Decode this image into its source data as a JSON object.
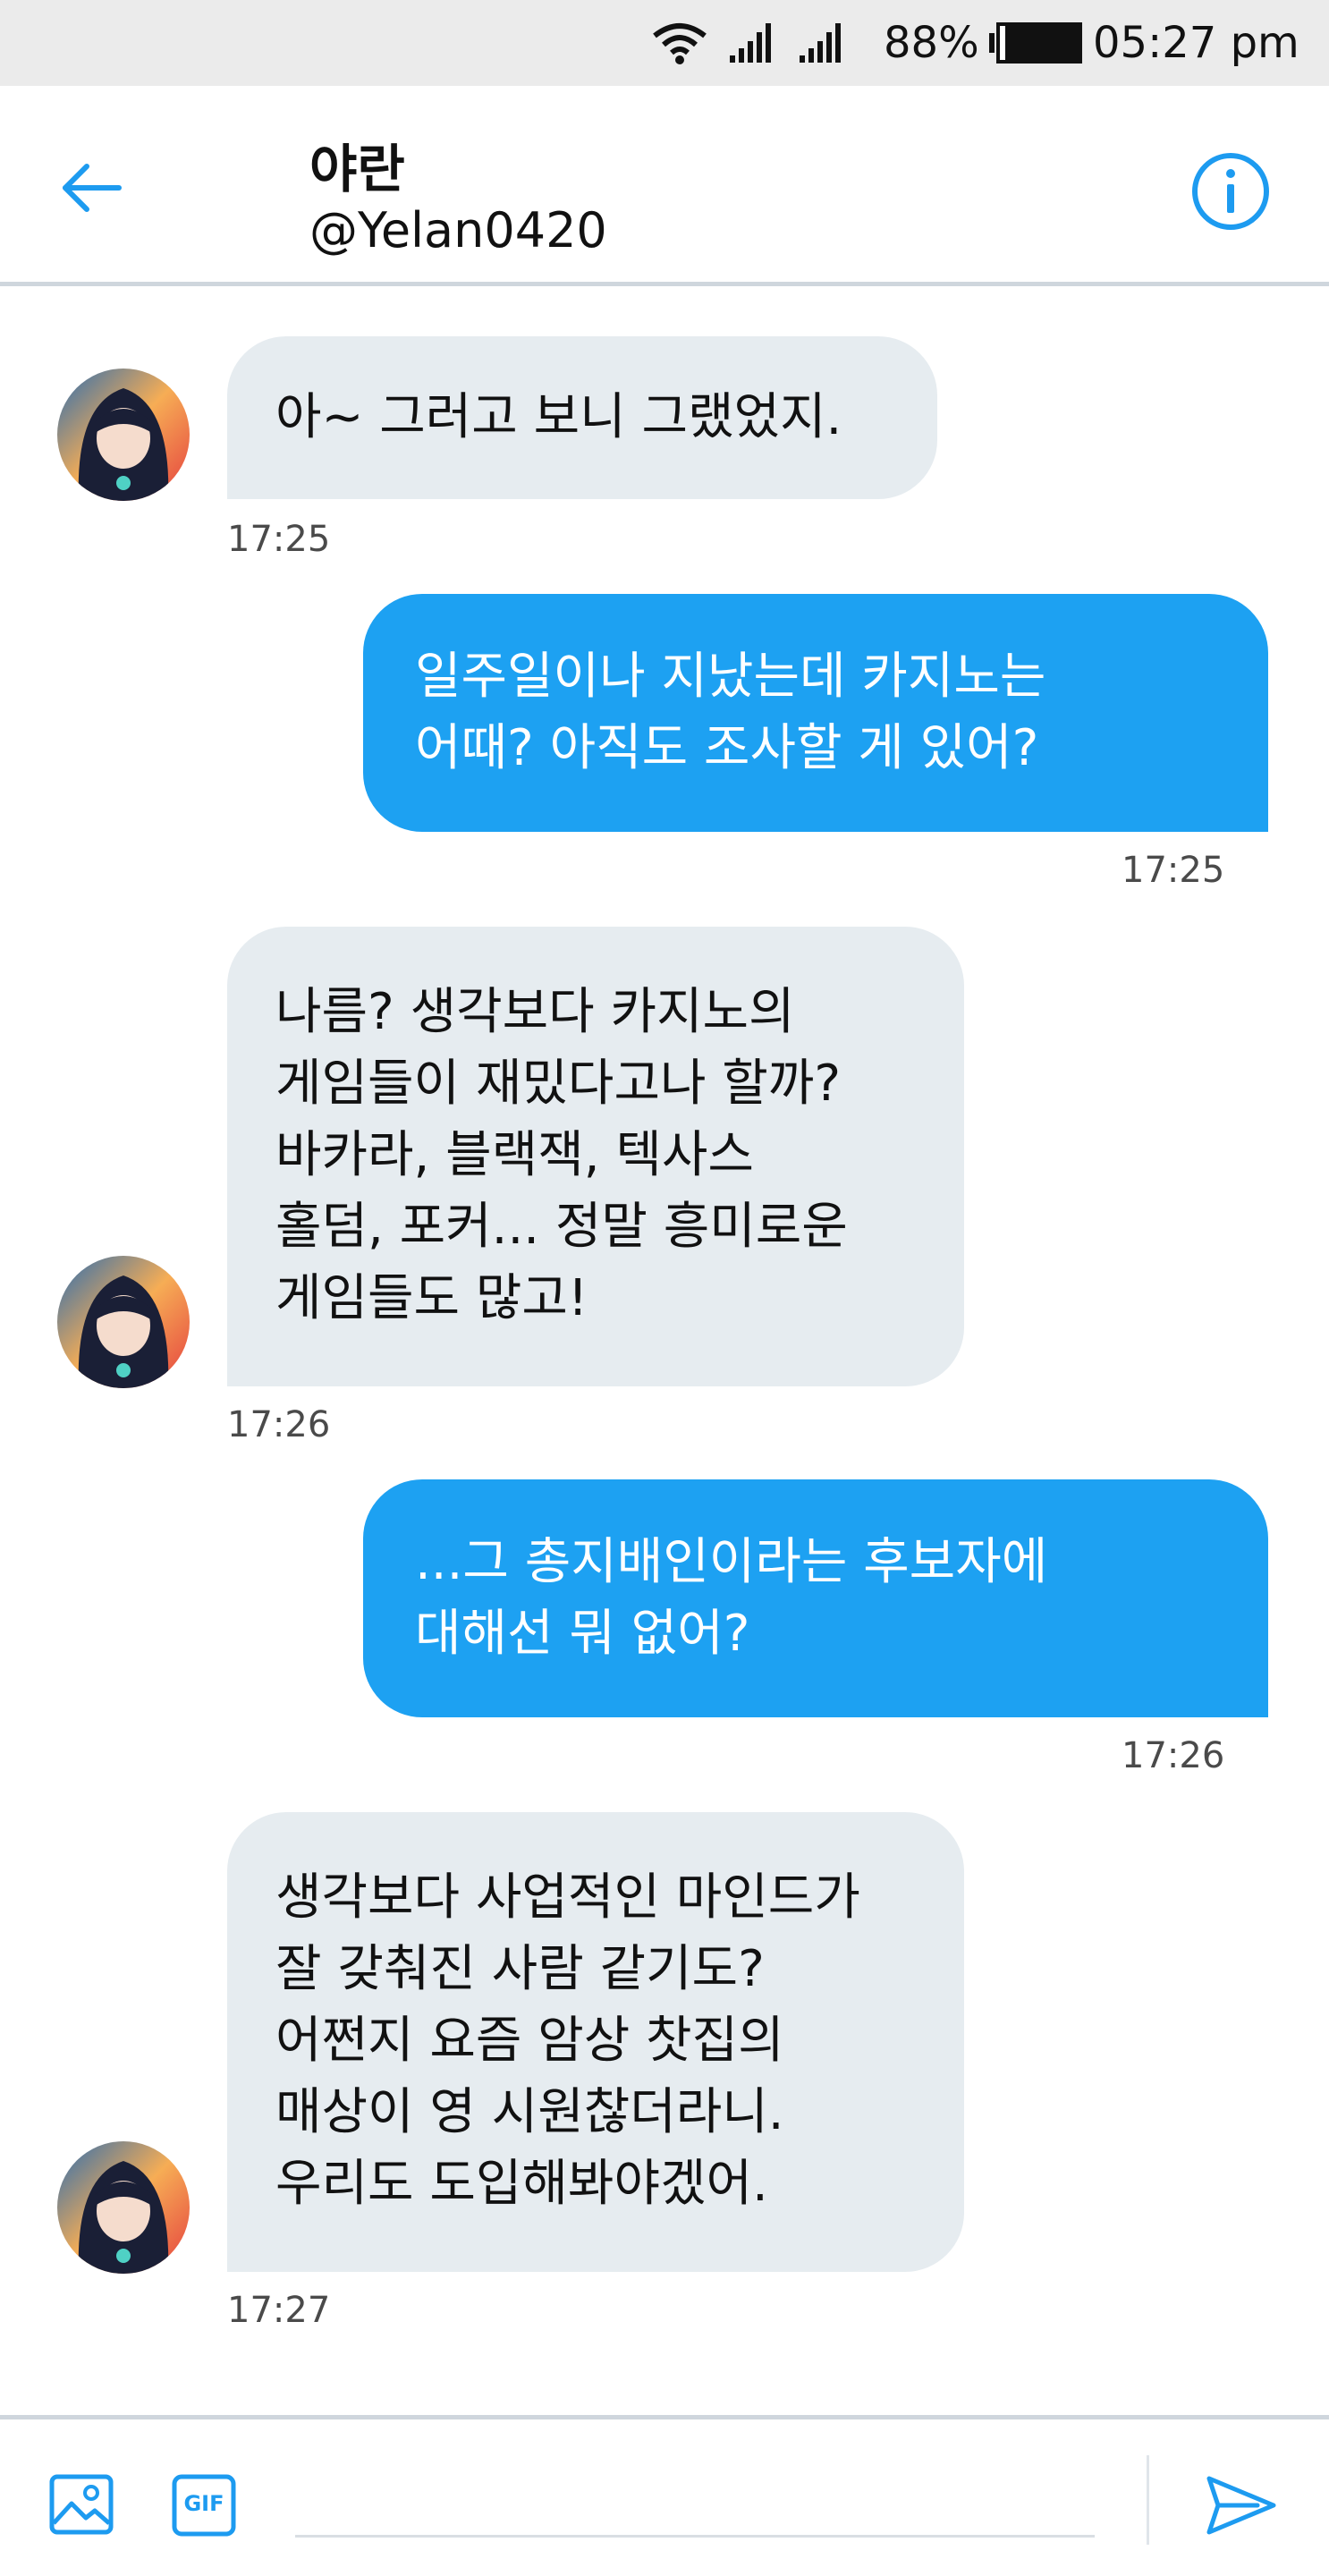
{
  "status_bar": {
    "battery_text": "88%",
    "time": "05:27 pm"
  },
  "header": {
    "name": "야란",
    "handle": "@Yelan0420",
    "accent": "#1d9bf0"
  },
  "messages": [
    {
      "direction": "in",
      "text": "아~ 그러고 보니 그랬었지.",
      "time": "17:25"
    },
    {
      "direction": "out",
      "text": "일주일이나 지났는데 카지노는\n어때? 아직도 조사할 게 있어?",
      "time": "17:25"
    },
    {
      "direction": "in",
      "text": "나름? 생각보다 카지노의\n게임들이 재밌다고나 할까?\n바카라, 블랙잭, 텍사스\n홀덤, 포커... 정말 흥미로운\n게임들도 많고!",
      "time": "17:26"
    },
    {
      "direction": "out",
      "text": "...그 총지배인이라는 후보자에\n대해선 뭐 없어?",
      "time": "17:26"
    },
    {
      "direction": "in",
      "text": "생각보다 사업적인 마인드가\n잘 갖춰진 사람 같기도?\n어쩐지 요즘 암상 찻집의\n매상이 영 시원찮더라니.\n우리도 도입해봐야겠어.",
      "time": "17:27"
    }
  ],
  "composer": {
    "image_icon": "image-icon",
    "gif_label": "GIF",
    "send_icon": "send-icon"
  },
  "colors": {
    "outgoing_bubble": "#1da1f2",
    "incoming_bubble": "#e6ecf0",
    "status_bar_bg": "#ebebeb"
  }
}
